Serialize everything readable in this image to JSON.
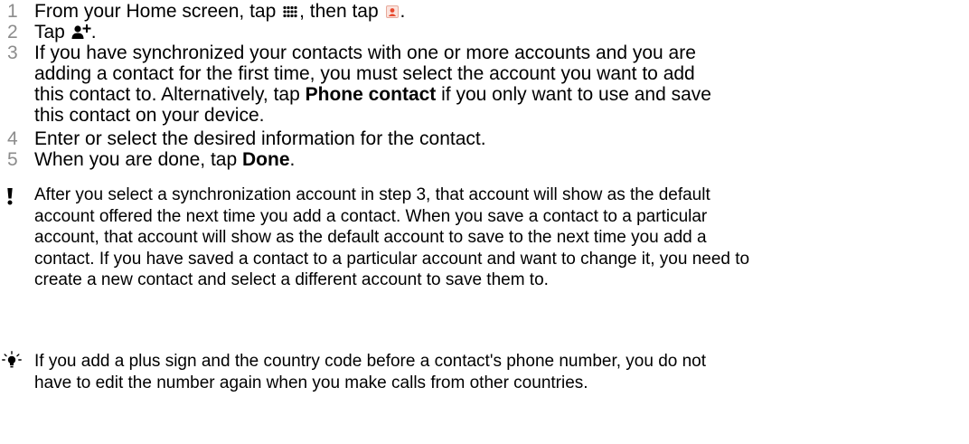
{
  "steps": [
    {
      "num": "1",
      "part1": "From your Home screen, tap ",
      "icon1": "app-grid-icon",
      "part2": ", then tap ",
      "icon2": "contacts-app-icon",
      "part3": "."
    },
    {
      "num": "2",
      "part1": "Tap ",
      "icon1": "add-contact-icon",
      "part2": "."
    },
    {
      "num": "3",
      "part1": "If you have synchronized your contacts with one or more accounts and you are",
      "part2": "adding a contact for the first time, you must select the account you want to add",
      "part3": "this contact to. Alternatively, tap ",
      "bold": "Phone contact",
      "part4": " if you only want to use and save",
      "part5": "this contact on your device."
    },
    {
      "num": "4",
      "part1": "Enter or select the desired information for the contact."
    },
    {
      "num": "5",
      "part1": "When you are done, tap ",
      "bold": "Done",
      "part2": "."
    }
  ],
  "notes": [
    {
      "icon": "exclamation-icon",
      "lines": [
        "After you select a synchronization account in step 3, that account will show as the default",
        "account offered the next time you add a contact. When you save a contact to a particular",
        "account, that account will show as the default account to save to the next time you add a",
        "contact. If you have saved a contact to a particular account and want to change it, you need to",
        "create a new contact and select a different account to save them to."
      ]
    },
    {
      "icon": "lightbulb-tip-icon",
      "lines": [
        "If you add a plus sign and the country code before a contact's phone number, you do not",
        "have to edit the number again when you make calls from other countries."
      ]
    }
  ],
  "colors": {
    "step_number": "#8c8c8c",
    "text": "#000000",
    "contacts_icon_accent": "#e8492f"
  }
}
